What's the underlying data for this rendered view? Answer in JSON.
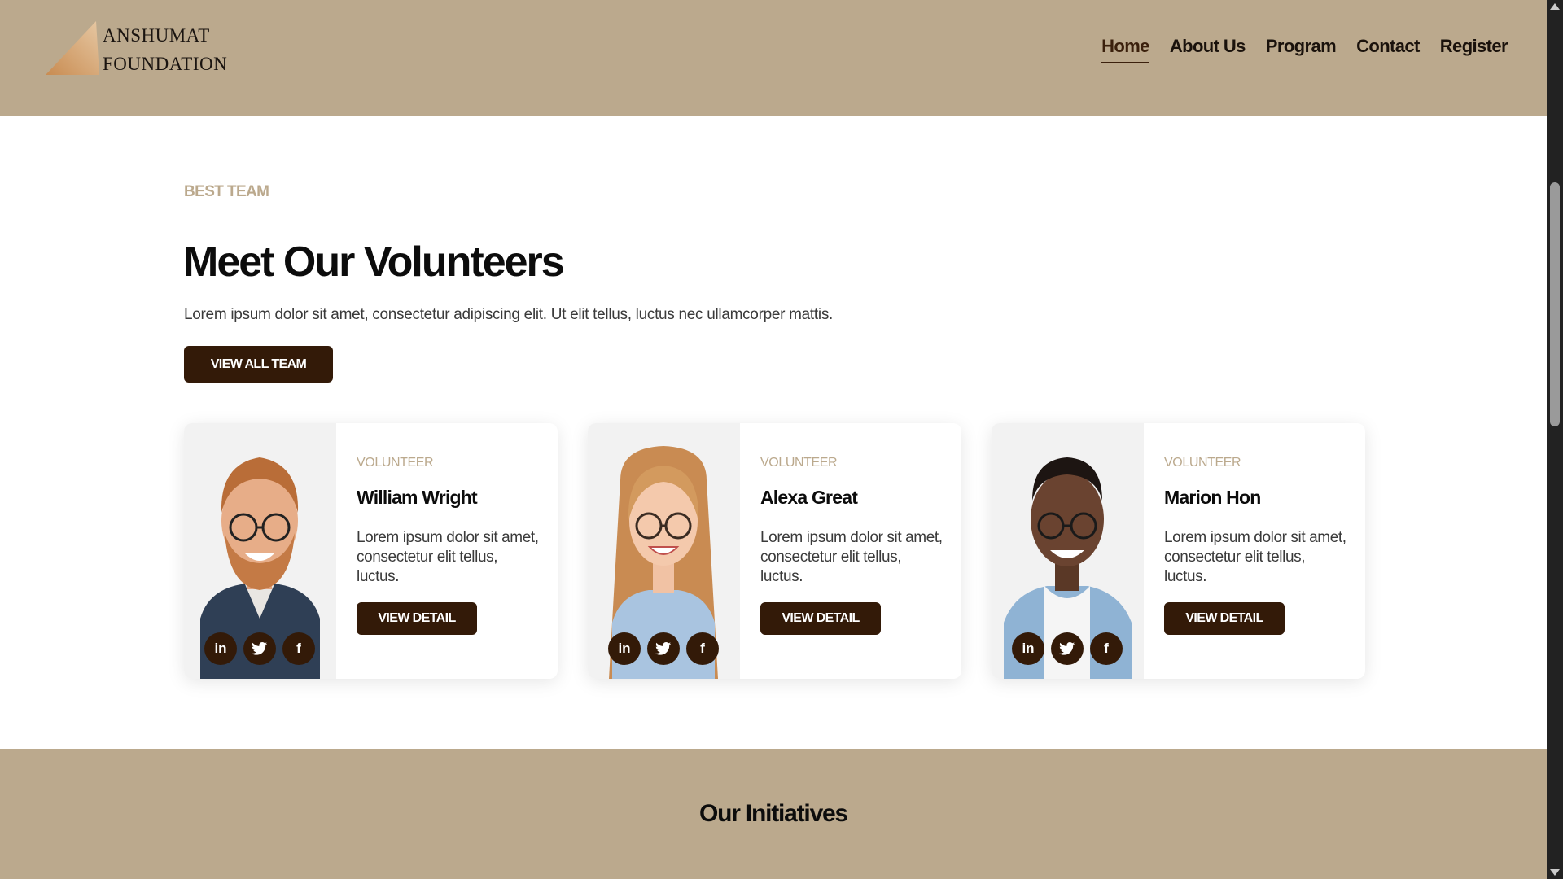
{
  "colors": {
    "accent": "#BBA98D",
    "dark": "#331A08",
    "text": "#0c0c0c"
  },
  "header": {
    "logo_line1": "ANSHUMAT",
    "logo_line2": "FOUNDATION",
    "nav": [
      "Home",
      "About Us",
      "Program",
      "Contact",
      "Register"
    ],
    "active_nav": "Home"
  },
  "team": {
    "eyebrow": "BEST TEAM",
    "title": "Meet Our Volunteers",
    "subtitle": "Lorem ipsum dolor sit amet, consectetur adipiscing elit. Ut elit tellus, luctus nec ullamcorper mattis.",
    "view_all_label": "VIEW ALL TEAM",
    "members": [
      {
        "role": "VOLUNTEER",
        "name": "William Wright",
        "desc": "Lorem ipsum dolor sit amet, consectetur elit tellus, luctus.",
        "button": "VIEW DETAIL"
      },
      {
        "role": "VOLUNTEER",
        "name": "Alexa Great",
        "desc": "Lorem ipsum dolor sit amet, consectetur elit tellus, luctus.",
        "button": "VIEW DETAIL"
      },
      {
        "role": "VOLUNTEER",
        "name": "Marion Hon",
        "desc": "Lorem ipsum dolor sit amet, consectetur elit tellus, luctus.",
        "button": "VIEW DETAIL"
      }
    ],
    "social_icons": [
      "linkedin-icon",
      "twitter-icon",
      "facebook-icon"
    ]
  },
  "initiatives": {
    "title": "Our Initiatives"
  }
}
